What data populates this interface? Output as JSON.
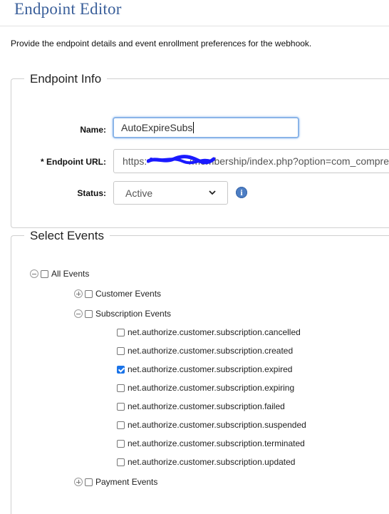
{
  "header": {
    "title": "Endpoint Editor",
    "intro": "Provide the endpoint details and event enrollment preferences for the webhook."
  },
  "endpoint_info": {
    "legend": "Endpoint Info",
    "name_label": "Name:",
    "name_value": "AutoExpireSubs",
    "url_label": "* Endpoint URL:",
    "url_prefix": "https:",
    "url_rest": "/membership/index.php?option=com_compre",
    "status_label": "Status:",
    "status_value": "Active",
    "info_icon": "info-icon"
  },
  "events": {
    "legend": "Select Events",
    "all_label": "All Events",
    "customer_label": "Customer Events",
    "subscription_label": "Subscription Events",
    "subscription_items": [
      {
        "label": "net.authorize.customer.subscription.cancelled",
        "checked": false
      },
      {
        "label": "net.authorize.customer.subscription.created",
        "checked": false
      },
      {
        "label": "net.authorize.customer.subscription.expired",
        "checked": true
      },
      {
        "label": "net.authorize.customer.subscription.expiring",
        "checked": false
      },
      {
        "label": "net.authorize.customer.subscription.failed",
        "checked": false
      },
      {
        "label": "net.authorize.customer.subscription.suspended",
        "checked": false
      },
      {
        "label": "net.authorize.customer.subscription.terminated",
        "checked": false
      },
      {
        "label": "net.authorize.customer.subscription.updated",
        "checked": false
      }
    ],
    "payment_label": "Payment Events"
  },
  "colors": {
    "title": "#3a5f9a",
    "checkbox_checked": "#1a73e8",
    "redaction": "#1a1aff",
    "info_icon": "#4d7ec4"
  }
}
